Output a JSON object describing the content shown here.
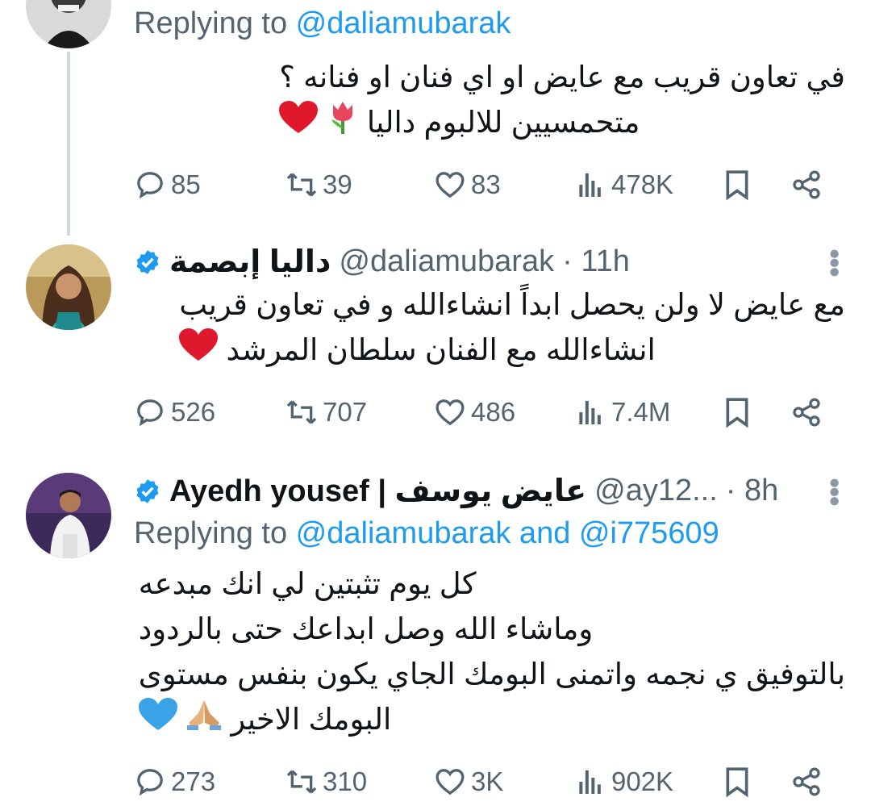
{
  "tweets": [
    {
      "replying_prefix": "Replying to ",
      "replying_mentions": "@daliamubarak",
      "lines": [
        "في تعاون قريب مع عايض او اي فنان او فنانه ؟",
        "متحمسيين للالبوم داليا"
      ],
      "stats": {
        "replies": "85",
        "retweets": "39",
        "likes": "83",
        "views": "478K"
      }
    },
    {
      "name": "داليا إبصمة",
      "handle": "@daliamubarak",
      "time": "· 11h",
      "lines": [
        "مع عايض لا ولن يحصل ابداً انشاءالله و في تعاون قريب",
        "انشاءالله مع الفنان سلطان المرشد"
      ],
      "stats": {
        "replies": "526",
        "retweets": "707",
        "likes": "486",
        "views": "7.4M"
      }
    },
    {
      "name": "Ayedh yousef | عايض يوسف",
      "handle": "@ay12...",
      "time": "· 8h",
      "replying_prefix": "Replying to ",
      "replying_mentions": "@daliamubarak and @i775609",
      "lines": [
        "كل يوم تثبتين لي انك مبدعه",
        "وماشاء الله وصل ابداعك حتى بالردود",
        "بالتوفيق ي نجمه واتمنى البومك الجاي يكون بنفس مستوى",
        "البومك الاخير"
      ],
      "stats": {
        "replies": "273",
        "retweets": "310",
        "likes": "3K",
        "views": "902K"
      }
    }
  ],
  "colors": {
    "accent": "#1d9bf0",
    "muted": "#536471",
    "heart_red": "#e0182d",
    "heart_blue": "#3aa3e8"
  },
  "icons": [
    "reply-icon",
    "retweet-icon",
    "like-icon",
    "views-icon",
    "bookmark-icon",
    "share-icon",
    "verified-badge-icon",
    "more-icon"
  ]
}
